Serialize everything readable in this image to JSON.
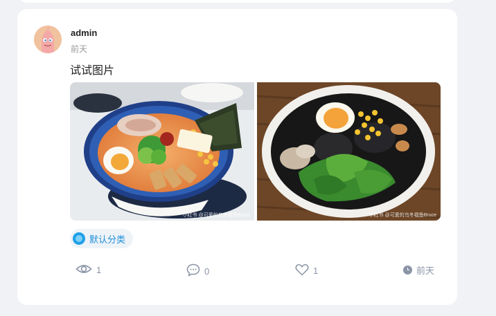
{
  "post": {
    "author": "admin",
    "time": "前天",
    "text": "试试图片",
    "images": [
      {
        "name": "miso-ramen-photo",
        "watermark": "小红书 @可爱的乌冬福鱼Bruce"
      },
      {
        "name": "black-ramen-photo",
        "watermark": "小红书 @可爱的乌冬福鱼Bruce"
      }
    ],
    "category": "默认分类"
  },
  "stats": {
    "views": "1",
    "comments": "0",
    "likes": "1",
    "time": "前天"
  },
  "colors": {
    "background": "#f0f2f5",
    "card": "#ffffff",
    "accent": "#1f8fd8",
    "muted": "#8a94a6"
  },
  "icons": {
    "views": "eye-icon",
    "comments": "comment-bubble-icon",
    "likes": "heart-icon",
    "time": "clock-icon",
    "category": "category-dot-icon"
  }
}
